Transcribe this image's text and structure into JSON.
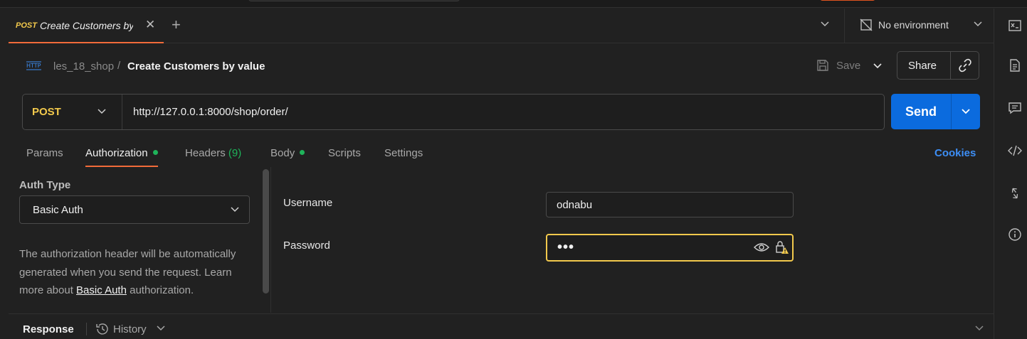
{
  "tab": {
    "method": "POST",
    "title": "Create Customers by value"
  },
  "environment": {
    "label": "No environment"
  },
  "breadcrumb": {
    "parent": "les_18_shop",
    "separator": "/",
    "current": "Create Customers by value"
  },
  "actions": {
    "save_label": "Save",
    "share_label": "Share"
  },
  "request": {
    "method": "POST",
    "url": "http://127.0.0.1:8000/shop/order/",
    "send_label": "Send"
  },
  "request_tabs": [
    {
      "label": "Params",
      "active": false
    },
    {
      "label": "Authorization",
      "active": true,
      "dot": true
    },
    {
      "label": "Headers",
      "count": "(9)"
    },
    {
      "label": "Body",
      "dot": true
    },
    {
      "label": "Scripts"
    },
    {
      "label": "Settings"
    }
  ],
  "cookies_label": "Cookies",
  "auth": {
    "type_label": "Auth Type",
    "type_value": "Basic Auth",
    "desc_prefix": "The authorization header will be automatically generated when you send the request. Learn more about ",
    "desc_link": "Basic Auth",
    "desc_suffix": " authorization."
  },
  "fields": {
    "username_label": "Username",
    "username_value": "odnabu",
    "password_label": "Password",
    "password_value": "•••"
  },
  "response": {
    "label": "Response",
    "history_label": "History"
  },
  "colors": {
    "accent": "#f26b3a",
    "send": "#0b6bde",
    "method": "#f2c94c",
    "active_dot": "#1fb35a",
    "link": "#3d8ef5"
  }
}
